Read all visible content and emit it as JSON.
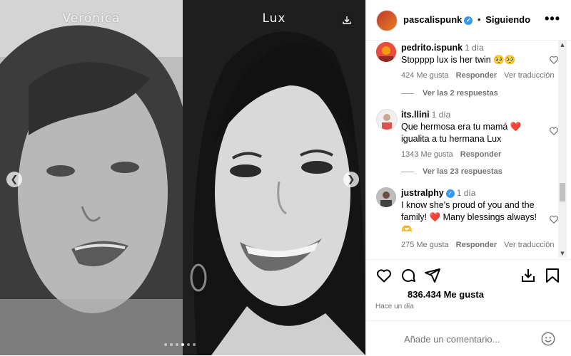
{
  "media": {
    "left_caption": "Verónica",
    "right_caption": "Lux",
    "prev_icon": "chevron-left-icon",
    "next_icon": "chevron-right-icon",
    "download_icon": "download-icon",
    "slide_count": 6,
    "active_slide": 4
  },
  "header": {
    "username": "pascalispunk",
    "separator": "•",
    "follow_status": "Siguiendo",
    "more_label": "•••"
  },
  "comments": [
    {
      "username": "pedrito.ispunk",
      "time": "1 día",
      "text": "Stopppp lux is her twin 🥺🥺",
      "likes": "424 Me gusta",
      "reply_label": "Responder",
      "translate_label": "Ver traducción",
      "verified": false
    },
    {
      "username": "its.llini",
      "time": "1 día",
      "text": "Que hermosa era tu mamá ❤️ igualita a tu hermana Lux",
      "likes": "1343 Me gusta",
      "reply_label": "Responder",
      "translate_label": "",
      "verified": false
    },
    {
      "username": "justralphy",
      "time": "1 día",
      "text": "I know she's proud of you and the family! ❤️ Many blessings always! 🫶",
      "likes": "275 Me gusta",
      "reply_label": "Responder",
      "translate_label": "Ver traducción",
      "verified": true
    }
  ],
  "reply_threads": [
    "Ver las 2 respuestas",
    "Ver las 23 respuestas"
  ],
  "actions": {
    "like_icon": "heart-icon",
    "comment_icon": "comment-icon",
    "share_icon": "share-icon",
    "save_download_icon": "download-icon",
    "bookmark_icon": "bookmark-icon"
  },
  "post": {
    "likes": "836.434 Me gusta",
    "time": "Hace un día"
  },
  "composer": {
    "placeholder": "Añade un comentario...",
    "emoji_icon": "emoji-icon"
  },
  "colors": {
    "verified": "#3897f0",
    "muted_text": "#737373",
    "border": "#efefef"
  }
}
